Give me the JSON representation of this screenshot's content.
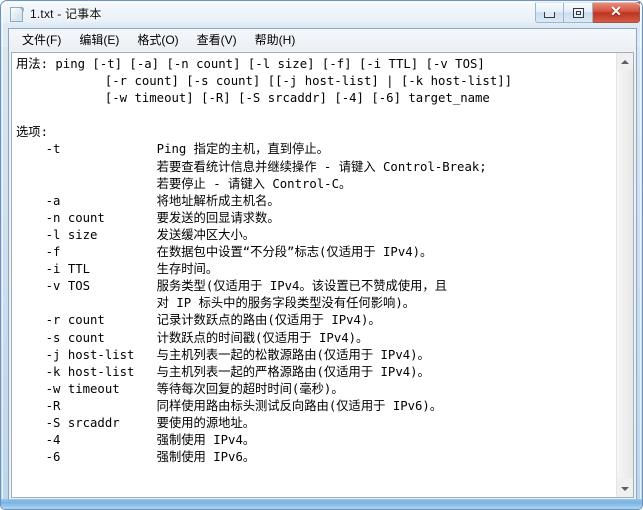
{
  "window": {
    "title": "1.txt - 记事本",
    "icon": "notepad-document-icon",
    "accent_close": "#bd3322",
    "frame_color": "#6a93bd"
  },
  "caption_buttons": {
    "minimize_label": "",
    "maximize_label": "",
    "close_label": "✕"
  },
  "menubar": {
    "items": [
      {
        "label": "文件(F)",
        "name": "menu-file"
      },
      {
        "label": "编辑(E)",
        "name": "menu-edit"
      },
      {
        "label": "格式(O)",
        "name": "menu-format"
      },
      {
        "label": "查看(V)",
        "name": "menu-view"
      },
      {
        "label": "帮助(H)",
        "name": "menu-help"
      }
    ]
  },
  "editor": {
    "content": "用法: ping [-t] [-a] [-n count] [-l size] [-f] [-i TTL] [-v TOS]\n            [-r count] [-s count] [[-j host-list] | [-k host-list]]\n            [-w timeout] [-R] [-S srcaddr] [-4] [-6] target_name\n\n选项:\n    -t             Ping 指定的主机，直到停止。\n                   若要查看统计信息并继续操作 - 请键入 Control-Break;\n                   若要停止 - 请键入 Control-C。\n    -a             将地址解析成主机名。\n    -n count       要发送的回显请求数。\n    -l size        发送缓冲区大小。\n    -f             在数据包中设置“不分段”标志(仅适用于 IPv4)。\n    -i TTL         生存时间。\n    -v TOS         服务类型(仅适用于 IPv4。该设置已不赞成使用，且\n                   对 IP 标头中的服务字段类型没有任何影响)。\n    -r count       记录计数跃点的路由(仅适用于 IPv4)。\n    -s count       计数跃点的时间戳(仅适用于 IPv4)。\n    -j host-list   与主机列表一起的松散源路由(仅适用于 IPv4)。\n    -k host-list   与主机列表一起的严格源路由(仅适用于 IPv4)。\n    -w timeout     等待每次回复的超时时间(毫秒)。\n    -R             同样使用路由标头测试反向路由(仅适用于 IPv6)。\n    -S srcaddr     要使用的源地址。\n    -4             强制使用 IPv4。\n    -6             强制使用 IPv6。"
  },
  "scrollbar": {
    "up_arrow": "scroll-up-arrow",
    "down_arrow": "scroll-down-arrow",
    "orientation": "vertical"
  }
}
